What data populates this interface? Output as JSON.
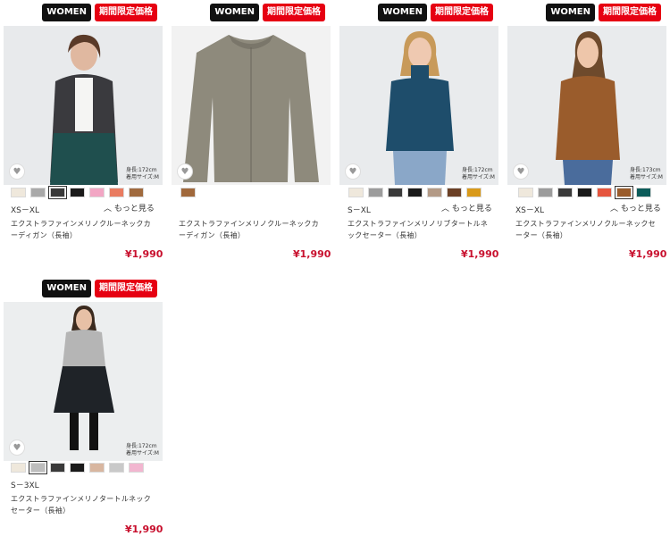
{
  "badges": {
    "women": "WOMEN",
    "sale": "期間限定価格"
  },
  "fav_icon": "heart-icon",
  "more_icon": "chevron-up-icon",
  "products": [
    {
      "model_info": [
        "身長:172cm",
        "着用サイズ:M"
      ],
      "colors": [
        "#efe8dc",
        "#a9a9a9",
        "#3a3a3a",
        "#1a1a1a",
        "#f2a6c4",
        "#e97c61",
        "#a06a3e"
      ],
      "selected": 2,
      "size": "XS－XL",
      "more": "もっと見る",
      "name": "エクストラファインメリノクルーネックカーディガン（長袖）",
      "price": "¥1,990"
    },
    {
      "model_info": [],
      "colors": [
        "#a0683b"
      ],
      "selected": -1,
      "size": "",
      "more": "",
      "name": "エクストラファインメリノクルーネックカーディガン（長袖）",
      "price": "¥1,990"
    },
    {
      "model_info": [
        "身長:172cm",
        "着用サイズ:M"
      ],
      "colors": [
        "#efe8dc",
        "#9c9c9c",
        "#3a3a3a",
        "#1a1a1a",
        "#b39a86",
        "#6b4026",
        "#d99a1a"
      ],
      "selected": -1,
      "size": "S－XL",
      "more": "もっと見る",
      "name": "エクストラファインメリノリブタートルネックセーター（長袖）",
      "price": "¥1,990"
    },
    {
      "model_info": [
        "身長:173cm",
        "着用サイズ:M"
      ],
      "colors": [
        "#efe8dc",
        "#9c9c9c",
        "#3a3a3a",
        "#1a1a1a",
        "#e5553e",
        "#9a5c2c",
        "#0c5c5a"
      ],
      "selected": 5,
      "size": "XS－XL",
      "more": "もっと見る",
      "name": "エクストラファインメリノクルーネックセーター（長袖）",
      "price": "¥1,990"
    },
    {
      "model_info": [
        "身長:172cm",
        "着用サイズ:M"
      ],
      "colors": [
        "#efe8dc",
        "#bdbdbd",
        "#3a3a3a",
        "#1a1a1a",
        "#d8b6a0",
        "#c9c9c9",
        "#f2b6d0"
      ],
      "selected": 1,
      "size": "S－3XL",
      "more": "",
      "name": "エクストラファインメリノタートルネックセーター（長袖）",
      "price": "¥1,990"
    }
  ]
}
